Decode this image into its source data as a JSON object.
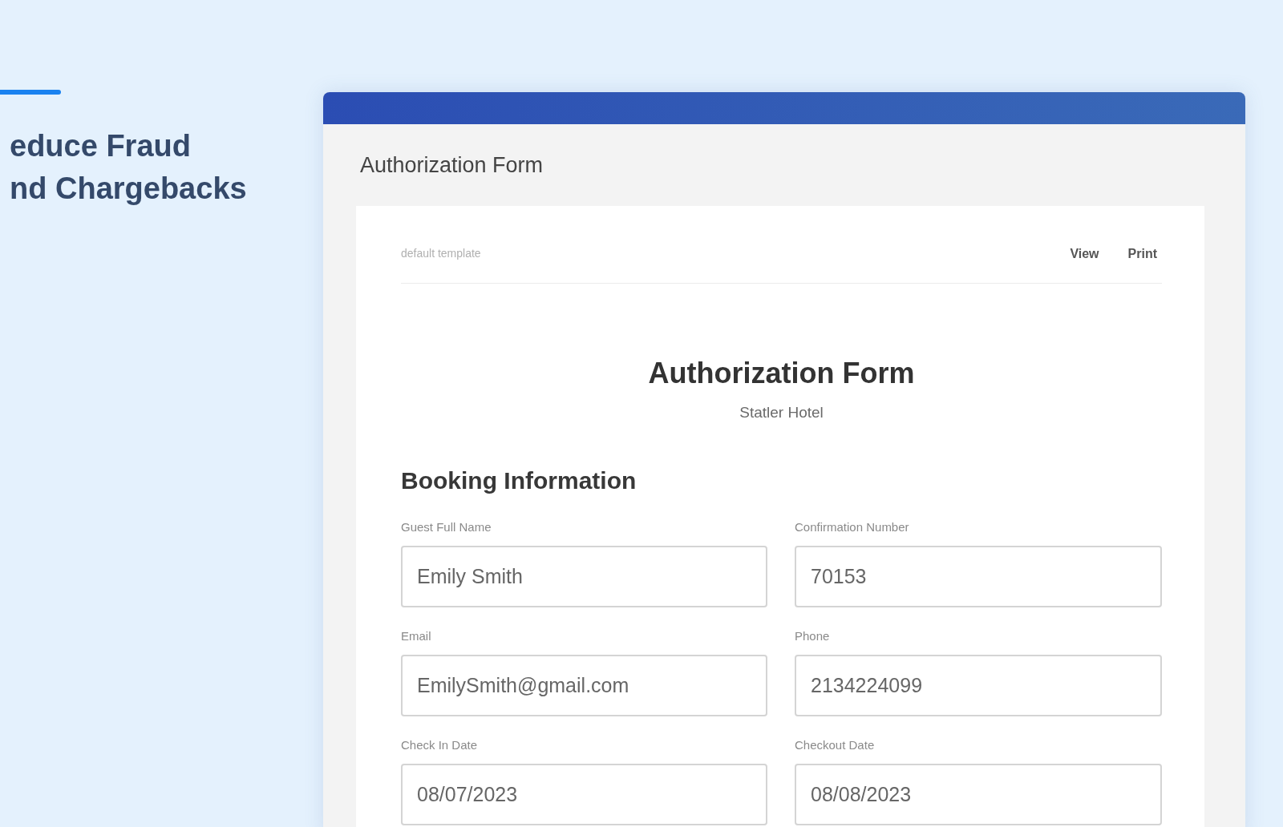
{
  "intro": {
    "heading_lines": [
      "educe Fraud",
      "nd Chargebacks"
    ]
  },
  "panel": {
    "title": "Authorization Form"
  },
  "document": {
    "template": "default template",
    "actions": [
      "View",
      "Print"
    ],
    "title": "Authorization Form",
    "subtitle": "Statler Hotel",
    "section": "Booking Information",
    "fields": [
      {
        "label": "Guest Full Name",
        "value": "Emily Smith"
      },
      {
        "label": "Confirmation Number",
        "value": "70153"
      },
      {
        "label": "Email",
        "value": "EmilySmith@gmail.com"
      },
      {
        "label": "Phone",
        "value": "2134224099"
      },
      {
        "label": "Check In Date",
        "value": "08/07/2023"
      },
      {
        "label": "Checkout Date",
        "value": "08/08/2023"
      }
    ]
  }
}
